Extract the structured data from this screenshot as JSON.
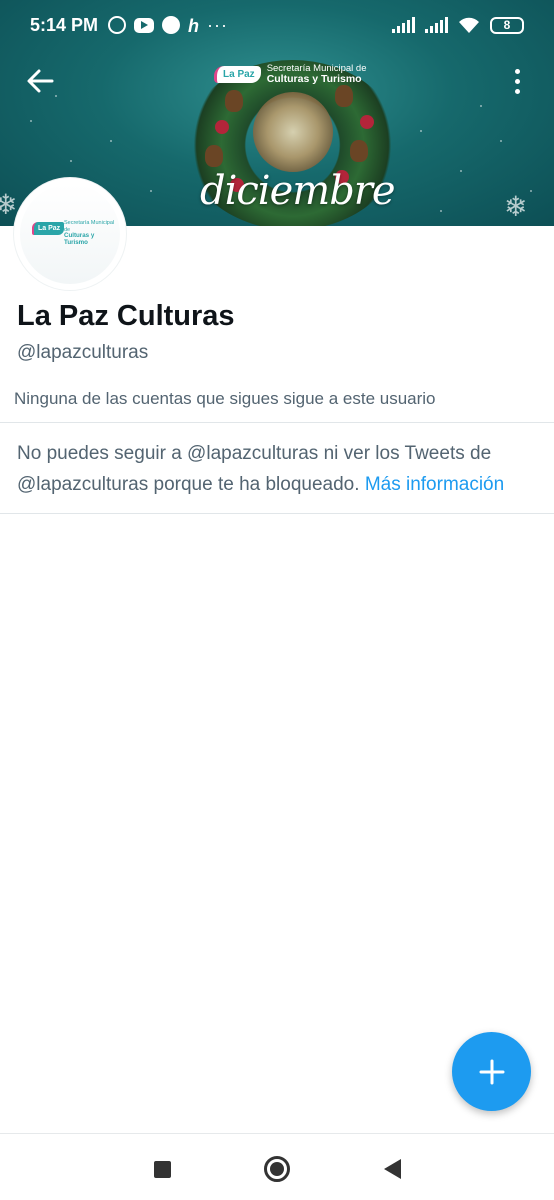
{
  "status_bar": {
    "time": "5:14 PM",
    "app_icons": [
      "messenger-icon",
      "youtube-icon",
      "app-icon",
      "h-app-icon"
    ],
    "overflow": "···",
    "battery_level": "8"
  },
  "banner": {
    "logo_badge": "La Paz",
    "logo_line1": "Secretaría Municipal de",
    "logo_line2": "Culturas y Turismo",
    "word": "diciembre"
  },
  "avatar": {
    "badge": "La Paz",
    "line1": "Secretaría Municipal de",
    "line2": "Culturas y Turismo"
  },
  "profile": {
    "name": "La Paz Culturas",
    "handle": "@lapazculturas",
    "followers_note": "Ninguna de las cuentas que sigues sigue a este usuario"
  },
  "blocked": {
    "message": "No puedes seguir a @lapazculturas ni ver los Tweets de @lapazculturas porque te ha bloqueado.",
    "link": "Más información"
  },
  "colors": {
    "accent": "#1d9bf0",
    "banner_teal": "#16696c",
    "secondary_text": "#536471"
  }
}
